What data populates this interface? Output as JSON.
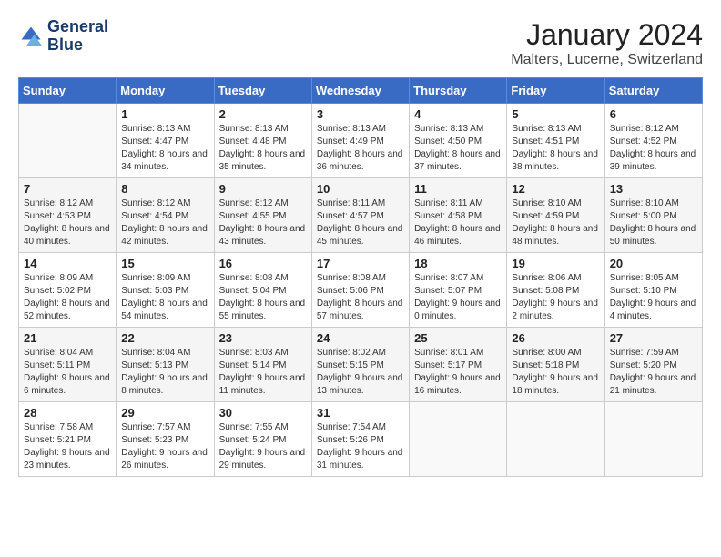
{
  "header": {
    "logo_line1": "General",
    "logo_line2": "Blue",
    "title": "January 2024",
    "subtitle": "Malters, Lucerne, Switzerland"
  },
  "weekdays": [
    "Sunday",
    "Monday",
    "Tuesday",
    "Wednesday",
    "Thursday",
    "Friday",
    "Saturday"
  ],
  "weeks": [
    [
      {
        "day": "",
        "sunrise": "",
        "sunset": "",
        "daylight": ""
      },
      {
        "day": "1",
        "sunrise": "Sunrise: 8:13 AM",
        "sunset": "Sunset: 4:47 PM",
        "daylight": "Daylight: 8 hours and 34 minutes."
      },
      {
        "day": "2",
        "sunrise": "Sunrise: 8:13 AM",
        "sunset": "Sunset: 4:48 PM",
        "daylight": "Daylight: 8 hours and 35 minutes."
      },
      {
        "day": "3",
        "sunrise": "Sunrise: 8:13 AM",
        "sunset": "Sunset: 4:49 PM",
        "daylight": "Daylight: 8 hours and 36 minutes."
      },
      {
        "day": "4",
        "sunrise": "Sunrise: 8:13 AM",
        "sunset": "Sunset: 4:50 PM",
        "daylight": "Daylight: 8 hours and 37 minutes."
      },
      {
        "day": "5",
        "sunrise": "Sunrise: 8:13 AM",
        "sunset": "Sunset: 4:51 PM",
        "daylight": "Daylight: 8 hours and 38 minutes."
      },
      {
        "day": "6",
        "sunrise": "Sunrise: 8:12 AM",
        "sunset": "Sunset: 4:52 PM",
        "daylight": "Daylight: 8 hours and 39 minutes."
      }
    ],
    [
      {
        "day": "7",
        "sunrise": "Sunrise: 8:12 AM",
        "sunset": "Sunset: 4:53 PM",
        "daylight": "Daylight: 8 hours and 40 minutes."
      },
      {
        "day": "8",
        "sunrise": "Sunrise: 8:12 AM",
        "sunset": "Sunset: 4:54 PM",
        "daylight": "Daylight: 8 hours and 42 minutes."
      },
      {
        "day": "9",
        "sunrise": "Sunrise: 8:12 AM",
        "sunset": "Sunset: 4:55 PM",
        "daylight": "Daylight: 8 hours and 43 minutes."
      },
      {
        "day": "10",
        "sunrise": "Sunrise: 8:11 AM",
        "sunset": "Sunset: 4:57 PM",
        "daylight": "Daylight: 8 hours and 45 minutes."
      },
      {
        "day": "11",
        "sunrise": "Sunrise: 8:11 AM",
        "sunset": "Sunset: 4:58 PM",
        "daylight": "Daylight: 8 hours and 46 minutes."
      },
      {
        "day": "12",
        "sunrise": "Sunrise: 8:10 AM",
        "sunset": "Sunset: 4:59 PM",
        "daylight": "Daylight: 8 hours and 48 minutes."
      },
      {
        "day": "13",
        "sunrise": "Sunrise: 8:10 AM",
        "sunset": "Sunset: 5:00 PM",
        "daylight": "Daylight: 8 hours and 50 minutes."
      }
    ],
    [
      {
        "day": "14",
        "sunrise": "Sunrise: 8:09 AM",
        "sunset": "Sunset: 5:02 PM",
        "daylight": "Daylight: 8 hours and 52 minutes."
      },
      {
        "day": "15",
        "sunrise": "Sunrise: 8:09 AM",
        "sunset": "Sunset: 5:03 PM",
        "daylight": "Daylight: 8 hours and 54 minutes."
      },
      {
        "day": "16",
        "sunrise": "Sunrise: 8:08 AM",
        "sunset": "Sunset: 5:04 PM",
        "daylight": "Daylight: 8 hours and 55 minutes."
      },
      {
        "day": "17",
        "sunrise": "Sunrise: 8:08 AM",
        "sunset": "Sunset: 5:06 PM",
        "daylight": "Daylight: 8 hours and 57 minutes."
      },
      {
        "day": "18",
        "sunrise": "Sunrise: 8:07 AM",
        "sunset": "Sunset: 5:07 PM",
        "daylight": "Daylight: 9 hours and 0 minutes."
      },
      {
        "day": "19",
        "sunrise": "Sunrise: 8:06 AM",
        "sunset": "Sunset: 5:08 PM",
        "daylight": "Daylight: 9 hours and 2 minutes."
      },
      {
        "day": "20",
        "sunrise": "Sunrise: 8:05 AM",
        "sunset": "Sunset: 5:10 PM",
        "daylight": "Daylight: 9 hours and 4 minutes."
      }
    ],
    [
      {
        "day": "21",
        "sunrise": "Sunrise: 8:04 AM",
        "sunset": "Sunset: 5:11 PM",
        "daylight": "Daylight: 9 hours and 6 minutes."
      },
      {
        "day": "22",
        "sunrise": "Sunrise: 8:04 AM",
        "sunset": "Sunset: 5:13 PM",
        "daylight": "Daylight: 9 hours and 8 minutes."
      },
      {
        "day": "23",
        "sunrise": "Sunrise: 8:03 AM",
        "sunset": "Sunset: 5:14 PM",
        "daylight": "Daylight: 9 hours and 11 minutes."
      },
      {
        "day": "24",
        "sunrise": "Sunrise: 8:02 AM",
        "sunset": "Sunset: 5:15 PM",
        "daylight": "Daylight: 9 hours and 13 minutes."
      },
      {
        "day": "25",
        "sunrise": "Sunrise: 8:01 AM",
        "sunset": "Sunset: 5:17 PM",
        "daylight": "Daylight: 9 hours and 16 minutes."
      },
      {
        "day": "26",
        "sunrise": "Sunrise: 8:00 AM",
        "sunset": "Sunset: 5:18 PM",
        "daylight": "Daylight: 9 hours and 18 minutes."
      },
      {
        "day": "27",
        "sunrise": "Sunrise: 7:59 AM",
        "sunset": "Sunset: 5:20 PM",
        "daylight": "Daylight: 9 hours and 21 minutes."
      }
    ],
    [
      {
        "day": "28",
        "sunrise": "Sunrise: 7:58 AM",
        "sunset": "Sunset: 5:21 PM",
        "daylight": "Daylight: 9 hours and 23 minutes."
      },
      {
        "day": "29",
        "sunrise": "Sunrise: 7:57 AM",
        "sunset": "Sunset: 5:23 PM",
        "daylight": "Daylight: 9 hours and 26 minutes."
      },
      {
        "day": "30",
        "sunrise": "Sunrise: 7:55 AM",
        "sunset": "Sunset: 5:24 PM",
        "daylight": "Daylight: 9 hours and 29 minutes."
      },
      {
        "day": "31",
        "sunrise": "Sunrise: 7:54 AM",
        "sunset": "Sunset: 5:26 PM",
        "daylight": "Daylight: 9 hours and 31 minutes."
      },
      {
        "day": "",
        "sunrise": "",
        "sunset": "",
        "daylight": ""
      },
      {
        "day": "",
        "sunrise": "",
        "sunset": "",
        "daylight": ""
      },
      {
        "day": "",
        "sunrise": "",
        "sunset": "",
        "daylight": ""
      }
    ]
  ]
}
